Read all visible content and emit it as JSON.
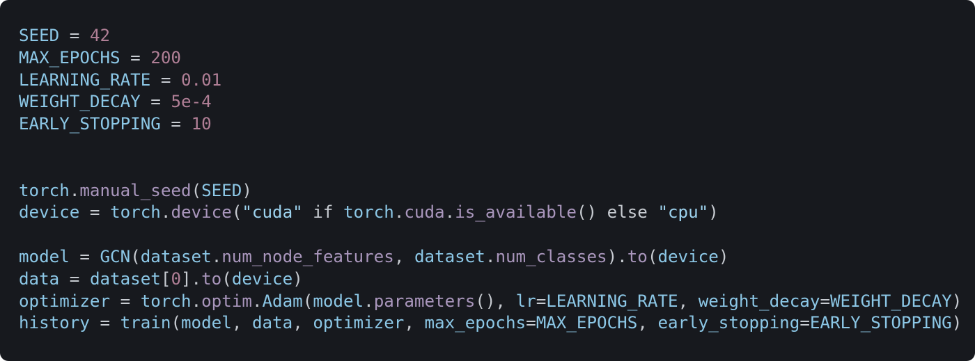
{
  "code": {
    "language": "python",
    "theme": {
      "background": "#17191e",
      "identifier": "#8cc7e6",
      "number": "#b07f96",
      "operator": "#c7cbd1",
      "attribute": "#a996bc",
      "string": "#9dd2ee"
    },
    "lines": [
      [
        {
          "t": "SEED",
          "k": "var"
        },
        {
          "t": " = ",
          "k": "op"
        },
        {
          "t": "42",
          "k": "num"
        }
      ],
      [
        {
          "t": "MAX_EPOCHS",
          "k": "var"
        },
        {
          "t": " = ",
          "k": "op"
        },
        {
          "t": "200",
          "k": "num"
        }
      ],
      [
        {
          "t": "LEARNING_RATE",
          "k": "var"
        },
        {
          "t": " = ",
          "k": "op"
        },
        {
          "t": "0.01",
          "k": "num"
        }
      ],
      [
        {
          "t": "WEIGHT_DECAY",
          "k": "var"
        },
        {
          "t": " = ",
          "k": "op"
        },
        {
          "t": "5e-4",
          "k": "num"
        }
      ],
      [
        {
          "t": "EARLY_STOPPING",
          "k": "var"
        },
        {
          "t": " = ",
          "k": "op"
        },
        {
          "t": "10",
          "k": "num"
        }
      ],
      [],
      [],
      [
        {
          "t": "torch",
          "k": "var"
        },
        {
          "t": ".",
          "k": "punc"
        },
        {
          "t": "manual_seed",
          "k": "attr"
        },
        {
          "t": "(",
          "k": "punc"
        },
        {
          "t": "SEED",
          "k": "var"
        },
        {
          "t": ")",
          "k": "punc"
        }
      ],
      [
        {
          "t": "device",
          "k": "var"
        },
        {
          "t": " = ",
          "k": "op"
        },
        {
          "t": "torch",
          "k": "var"
        },
        {
          "t": ".",
          "k": "punc"
        },
        {
          "t": "device",
          "k": "attr"
        },
        {
          "t": "(",
          "k": "punc"
        },
        {
          "t": "\"cuda\"",
          "k": "str"
        },
        {
          "t": " if ",
          "k": "kw"
        },
        {
          "t": "torch",
          "k": "var"
        },
        {
          "t": ".",
          "k": "punc"
        },
        {
          "t": "cuda",
          "k": "attr"
        },
        {
          "t": ".",
          "k": "punc"
        },
        {
          "t": "is_available",
          "k": "attr"
        },
        {
          "t": "() else ",
          "k": "punc"
        },
        {
          "t": "\"cpu\"",
          "k": "str"
        },
        {
          "t": ")",
          "k": "punc"
        }
      ],
      [],
      [
        {
          "t": "model",
          "k": "var"
        },
        {
          "t": " = ",
          "k": "op"
        },
        {
          "t": "GCN",
          "k": "class"
        },
        {
          "t": "(",
          "k": "punc"
        },
        {
          "t": "dataset",
          "k": "var"
        },
        {
          "t": ".",
          "k": "punc"
        },
        {
          "t": "num_node_features",
          "k": "attr"
        },
        {
          "t": ", ",
          "k": "punc"
        },
        {
          "t": "dataset",
          "k": "var"
        },
        {
          "t": ".",
          "k": "punc"
        },
        {
          "t": "num_classes",
          "k": "attr"
        },
        {
          "t": ").",
          "k": "punc"
        },
        {
          "t": "to",
          "k": "attr"
        },
        {
          "t": "(",
          "k": "punc"
        },
        {
          "t": "device",
          "k": "var"
        },
        {
          "t": ")",
          "k": "punc"
        }
      ],
      [
        {
          "t": "data",
          "k": "var"
        },
        {
          "t": " = ",
          "k": "op"
        },
        {
          "t": "dataset",
          "k": "var"
        },
        {
          "t": "[",
          "k": "punc"
        },
        {
          "t": "0",
          "k": "num"
        },
        {
          "t": "].",
          "k": "punc"
        },
        {
          "t": "to",
          "k": "attr"
        },
        {
          "t": "(",
          "k": "punc"
        },
        {
          "t": "device",
          "k": "var"
        },
        {
          "t": ")",
          "k": "punc"
        }
      ],
      [
        {
          "t": "optimizer",
          "k": "var"
        },
        {
          "t": " = ",
          "k": "op"
        },
        {
          "t": "torch",
          "k": "var"
        },
        {
          "t": ".",
          "k": "punc"
        },
        {
          "t": "optim",
          "k": "attr"
        },
        {
          "t": ".",
          "k": "punc"
        },
        {
          "t": "Adam",
          "k": "class"
        },
        {
          "t": "(",
          "k": "punc"
        },
        {
          "t": "model",
          "k": "var"
        },
        {
          "t": ".",
          "k": "punc"
        },
        {
          "t": "parameters",
          "k": "attr"
        },
        {
          "t": "(), ",
          "k": "punc"
        },
        {
          "t": "lr",
          "k": "var"
        },
        {
          "t": "=",
          "k": "op"
        },
        {
          "t": "LEARNING_RATE",
          "k": "var"
        },
        {
          "t": ", ",
          "k": "punc"
        },
        {
          "t": "weight_decay",
          "k": "var"
        },
        {
          "t": "=",
          "k": "op"
        },
        {
          "t": "WEIGHT_DECAY",
          "k": "var"
        },
        {
          "t": ")",
          "k": "punc"
        }
      ],
      [
        {
          "t": "history",
          "k": "var"
        },
        {
          "t": " = ",
          "k": "op"
        },
        {
          "t": "train",
          "k": "var"
        },
        {
          "t": "(",
          "k": "punc"
        },
        {
          "t": "model",
          "k": "var"
        },
        {
          "t": ", ",
          "k": "punc"
        },
        {
          "t": "data",
          "k": "var"
        },
        {
          "t": ", ",
          "k": "punc"
        },
        {
          "t": "optimizer",
          "k": "var"
        },
        {
          "t": ", ",
          "k": "punc"
        },
        {
          "t": "max_epochs",
          "k": "var"
        },
        {
          "t": "=",
          "k": "op"
        },
        {
          "t": "MAX_EPOCHS",
          "k": "var"
        },
        {
          "t": ", ",
          "k": "punc"
        },
        {
          "t": "early_stopping",
          "k": "var"
        },
        {
          "t": "=",
          "k": "op"
        },
        {
          "t": "EARLY_STOPPING",
          "k": "var"
        },
        {
          "t": ")",
          "k": "punc"
        }
      ]
    ]
  }
}
